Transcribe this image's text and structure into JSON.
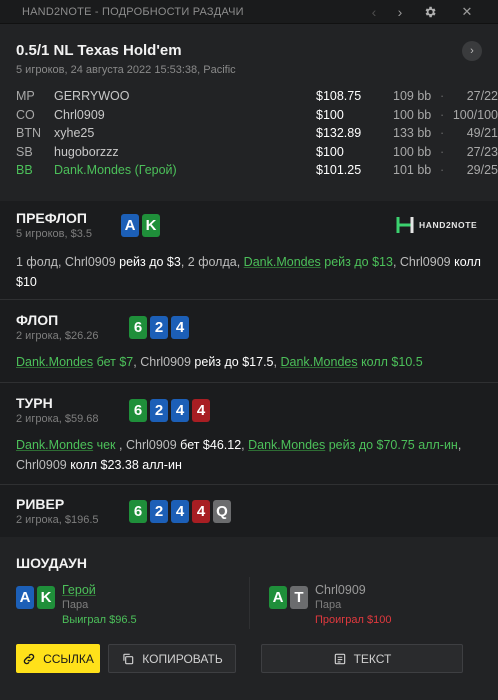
{
  "window": {
    "title": "HAND2NOTE - ПОДРОБНОСТИ РАЗДАЧИ"
  },
  "titlebar": {
    "prev_icon": "‹",
    "next_icon": "›",
    "settings_icon": "gear-icon",
    "close_icon": "✕"
  },
  "hand": {
    "title": "0.5/1 NL Texas Hold'em",
    "subtitle": "5 игроков, 24 августа 2022 15:53:38, Pacific",
    "next_icon": "›"
  },
  "players": [
    {
      "pos": "MP",
      "name": "GERRYWOO",
      "stack": "$108.75",
      "bb": "109 bb",
      "dot": "·",
      "vpip_pfr": "27/22",
      "hero": false
    },
    {
      "pos": "CO",
      "name": "Chrl0909",
      "stack": "$100",
      "bb": "100 bb",
      "dot": "·",
      "vpip_pfr": "100/100",
      "hero": false
    },
    {
      "pos": "BTN",
      "name": "xyhe25",
      "stack": "$132.89",
      "bb": "133 bb",
      "dot": "·",
      "vpip_pfr": "49/21",
      "hero": false
    },
    {
      "pos": "SB",
      "name": "hugoborzzz",
      "stack": "$100",
      "bb": "100 bb",
      "dot": "·",
      "vpip_pfr": "27/23",
      "hero": false
    },
    {
      "pos": "BB",
      "name": "Dank.Mondes (Герой)",
      "stack": "$101.25",
      "bb": "101 bb",
      "dot": "·",
      "vpip_pfr": "29/25",
      "hero": true
    }
  ],
  "logo": {
    "text": "HAND2NOTE"
  },
  "streets": {
    "preflop": {
      "title": "ПРЕФЛОП",
      "sub": "5 игроков, $3.5",
      "cards": [
        {
          "rank": "A",
          "suit": "blue"
        },
        {
          "rank": "K",
          "suit": "green"
        }
      ],
      "action": [
        {
          "t": "1 фолд, Chrl0909 ",
          "c": "n"
        },
        {
          "t": "рейз до $3",
          "c": "w"
        },
        {
          "t": ", 2 фолда, ",
          "c": "n"
        },
        {
          "t": "Dank.Mondes",
          "c": "h"
        },
        {
          "t": " рейз до $13",
          "c": "g"
        },
        {
          "t": ", Chrl0909 ",
          "c": "n"
        },
        {
          "t": "колл $10",
          "c": "w"
        }
      ]
    },
    "flop": {
      "title": "ФЛОП",
      "sub": "2 игрока, $26.26",
      "cards": [
        {
          "rank": "6",
          "suit": "green"
        },
        {
          "rank": "2",
          "suit": "blue"
        },
        {
          "rank": "4",
          "suit": "blue"
        }
      ],
      "action": [
        {
          "t": "Dank.Mondes",
          "c": "h"
        },
        {
          "t": " бет $7",
          "c": "g"
        },
        {
          "t": ", Chrl0909 ",
          "c": "n"
        },
        {
          "t": "рейз до $17.5",
          "c": "w"
        },
        {
          "t": ", ",
          "c": "n"
        },
        {
          "t": "Dank.Mondes",
          "c": "h"
        },
        {
          "t": " колл $10.5",
          "c": "g"
        }
      ]
    },
    "turn": {
      "title": "ТУРН",
      "sub": "2 игрока, $59.68",
      "cards": [
        {
          "rank": "6",
          "suit": "green"
        },
        {
          "rank": "2",
          "suit": "blue"
        },
        {
          "rank": "4",
          "suit": "blue"
        },
        {
          "rank": "4",
          "suit": "red"
        }
      ],
      "action": [
        {
          "t": "Dank.Mondes",
          "c": "h"
        },
        {
          "t": " чек ",
          "c": "g"
        },
        {
          "t": ", Chrl0909 ",
          "c": "n"
        },
        {
          "t": "бет $46.12",
          "c": "w"
        },
        {
          "t": ", ",
          "c": "n"
        },
        {
          "t": "Dank.Mondes",
          "c": "h"
        },
        {
          "t": " рейз до $70.75 алл-ин",
          "c": "g"
        },
        {
          "t": ", Chrl0909 ",
          "c": "n"
        },
        {
          "t": "колл $23.38 алл-ин",
          "c": "w"
        }
      ]
    },
    "river": {
      "title": "РИВЕР",
      "sub": "2 игрока, $196.5",
      "cards": [
        {
          "rank": "6",
          "suit": "green"
        },
        {
          "rank": "2",
          "suit": "blue"
        },
        {
          "rank": "4",
          "suit": "blue"
        },
        {
          "rank": "4",
          "suit": "red"
        },
        {
          "rank": "Q",
          "suit": "grey"
        }
      ]
    }
  },
  "showdown": {
    "title": "ШОУДАУН",
    "hero": {
      "name": "Герой",
      "combo": "Пара",
      "result": "Выиграл $96.5",
      "cards": [
        {
          "rank": "A",
          "suit": "blue"
        },
        {
          "rank": "K",
          "suit": "green"
        }
      ]
    },
    "villain": {
      "name": "Chrl0909",
      "combo": "Пара",
      "result": "Проиграл $100",
      "cards": [
        {
          "rank": "A",
          "suit": "green"
        },
        {
          "rank": "T",
          "suit": "grey"
        }
      ]
    }
  },
  "buttons": {
    "link": "ССЫЛКА",
    "copy": "КОПИРОВАТЬ",
    "text": "ТЕКСТ"
  },
  "colors": {
    "accent_yellow": "#ffe11a",
    "hero_green": "#4cc05a",
    "loss_red": "#e0393e",
    "card_blue": "#1c5fb7",
    "card_green": "#1f8f3a",
    "card_red": "#a81e23",
    "card_grey": "#6b6c6e"
  }
}
